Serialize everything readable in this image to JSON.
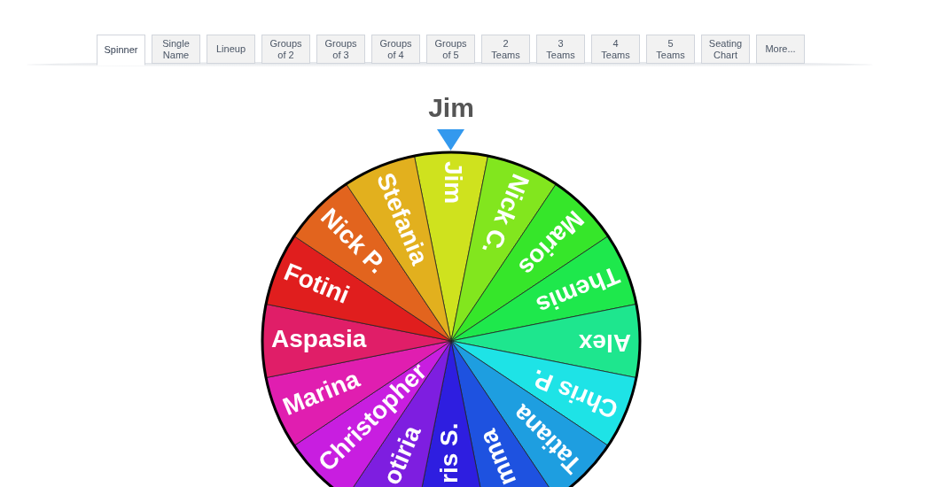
{
  "tabs": [
    {
      "label": "Spinner",
      "selected": true
    },
    {
      "label": "Single\nName",
      "selected": false
    },
    {
      "label": "Lineup",
      "selected": false
    },
    {
      "label": "Groups\nof 2",
      "selected": false
    },
    {
      "label": "Groups\nof 3",
      "selected": false
    },
    {
      "label": "Groups\nof 4",
      "selected": false
    },
    {
      "label": "Groups\nof 5",
      "selected": false
    },
    {
      "label": "2\nTeams",
      "selected": false
    },
    {
      "label": "3\nTeams",
      "selected": false
    },
    {
      "label": "4\nTeams",
      "selected": false
    },
    {
      "label": "5\nTeams",
      "selected": false
    },
    {
      "label": "Seating\nChart",
      "selected": false
    },
    {
      "label": "More...",
      "selected": false
    }
  ],
  "spinner": {
    "result": "Jim",
    "slices": [
      {
        "name": "Jim",
        "color": "#cfe21e"
      },
      {
        "name": "Nick C.",
        "color": "#82e61e"
      },
      {
        "name": "Marios",
        "color": "#36e62a"
      },
      {
        "name": "Themis",
        "color": "#1ee84c"
      },
      {
        "name": "Alex",
        "color": "#1ee68e"
      },
      {
        "name": "Chris P.",
        "color": "#1ee3e6"
      },
      {
        "name": "Tatiana",
        "color": "#1e9ee0"
      },
      {
        "name": "mma",
        "color": "#1e52e0"
      },
      {
        "name": "ris S.",
        "color": "#2e1ee0"
      },
      {
        "name": "otiria",
        "color": "#7e1ee0"
      },
      {
        "name": "Christopher",
        "color": "#c81ee0"
      },
      {
        "name": "Marina",
        "color": "#e01eb0"
      },
      {
        "name": "Aspasia",
        "color": "#e01e68"
      },
      {
        "name": "Fotini",
        "color": "#e01e1e"
      },
      {
        "name": "Nick P.",
        "color": "#e2641e"
      },
      {
        "name": "Stefania",
        "color": "#e2b01e"
      }
    ]
  }
}
